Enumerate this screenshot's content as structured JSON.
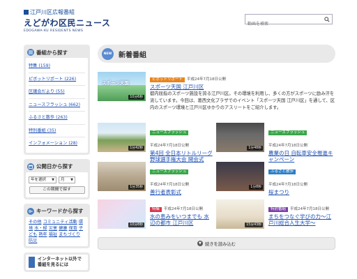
{
  "header": {
    "brand_line1": "江戸川区広報番組",
    "brand_line2": "えどがわ区民ニュース",
    "brand_line3": "EDOGAWA-KU RESIDENTS NEWS",
    "search_placeholder": "動画を検索"
  },
  "sidebar": {
    "program_heading": "番組から探す",
    "programs": [
      {
        "label": "特集 (159)"
      },
      {
        "label": "ピボットリポート (226)"
      },
      {
        "label": "区議会だより (55)"
      },
      {
        "label": "ニュースフラッシュ (662)"
      },
      {
        "label": "ふるさと散歩 (263)"
      },
      {
        "label": "特別番組 (35)"
      },
      {
        "label": "インフォメーション (28)"
      }
    ],
    "date_heading": "公開日から探す",
    "year_select": "年を選択",
    "month_select": "月",
    "date_button": "この期間で探す",
    "keyword_heading": "キーワードから探す",
    "keywords": [
      "その他",
      "コミュニティ活動",
      "環境",
      "水・緑",
      "災害",
      "健康",
      "保育",
      "子ども",
      "熟年",
      "福祉",
      "まちづくり",
      "防災"
    ],
    "internet_text": "インターネット以外で番組を見るには"
  },
  "main": {
    "badge": "NEW",
    "title": "新着番組",
    "more_label": "続きを読み込む"
  },
  "featured": {
    "category": "ピボットリポート",
    "category_color": "#e8841f",
    "date": "平成24年7月18日公開",
    "title": "スポーツ天国 江戸川区",
    "duration": "10分6秒",
    "thumb_caption": "スポーツ天国",
    "description": "都内屈指のスポーツ施設を誇る江戸川区。その環境を利用し、多くの方がスポーツに励み汗を流しています。今回は、葛西文化プラザでのイベント「スポーツ天国 江戸川区」を通して、区内のスポーツ環境と江戸川区ゆかりのアスリートをご紹介します。"
  },
  "videos": [
    {
      "category": "ニュースフラッシュ",
      "color": "#3aa64a",
      "date": "平成24年7月18日公開",
      "title": "第4回 全日本リトルリーグ野球選手権大会 開会式",
      "duration": "1分42秒"
    },
    {
      "category": "ニュースフラッシュ",
      "color": "#3aa64a",
      "date": "平成24年7月18日公開",
      "title": "農業の日 自転車安全推進キャンペーン",
      "duration": "1分48秒"
    },
    {
      "category": "ニュースフラッシュ",
      "color": "#3aa64a",
      "date": "平成24年7月18日公開",
      "title": "善行者表彰式",
      "duration": "1分35秒"
    },
    {
      "category": "ふるさと散歩",
      "color": "#2e7fc6",
      "date": "平成24年7月18日公開",
      "title": "桜まつり",
      "duration": "1分8秒"
    },
    {
      "category": "特集",
      "color": "#d9364b",
      "date": "平成24年7月18日公開",
      "title": "水の恵みをいつまでも 水辺の都市 江戸川区",
      "duration": "10分8秒"
    },
    {
      "category": "特別番組",
      "color": "#7b3fa6",
      "date": "平成24年7月18日公開",
      "title": "まちをつなぐ学びの力〜江戸川総合人生大学〜",
      "duration": "15分43秒"
    }
  ]
}
